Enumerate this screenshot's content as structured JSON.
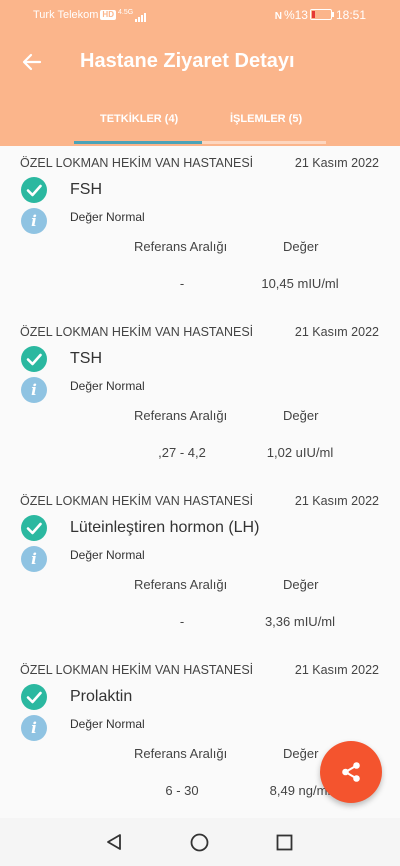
{
  "status_bar": {
    "carrier": "Turk Telekom",
    "network_badge": "HD",
    "network_type": "4.5G",
    "battery": "%13",
    "time": "18:51"
  },
  "header": {
    "title": "Hastane Ziyaret Detayı"
  },
  "tabs": [
    {
      "label": "TETKİKLER (4)",
      "active": true
    },
    {
      "label": "İŞLEMLER (5)",
      "active": false
    }
  ],
  "columns": {
    "reference": "Referans Aralığı",
    "value": "Değer"
  },
  "tests": [
    {
      "hospital": "ÖZEL LOKMAN HEKİM VAN HASTANESİ",
      "date": "21 Kasım 2022",
      "name": "FSH",
      "status": "Değer Normal",
      "reference": "-",
      "value": "10,45 mIU/ml"
    },
    {
      "hospital": "ÖZEL LOKMAN HEKİM VAN HASTANESİ",
      "date": "21 Kasım 2022",
      "name": "TSH",
      "status": "Değer Normal",
      "reference": ",27 - 4,2",
      "value": "1,02 uIU/ml"
    },
    {
      "hospital": "ÖZEL LOKMAN HEKİM VAN HASTANESİ",
      "date": "21 Kasım 2022",
      "name": "Lüteinleştiren hormon (LH)",
      "status": "Değer Normal",
      "reference": "-",
      "value": "3,36 mIU/ml"
    },
    {
      "hospital": "ÖZEL LOKMAN HEKİM VAN HASTANESİ",
      "date": "21 Kasım 2022",
      "name": "Prolaktin",
      "status": "Değer Normal",
      "reference": "6 - 30",
      "value": "8,49 ng/ml"
    }
  ],
  "colors": {
    "header": "#fbb58b",
    "tab_indicator": "#4aa3b8",
    "check": "#2bb8a0",
    "info": "#8fc3e2",
    "fab": "#f4542e"
  },
  "icons": {
    "back": "arrow-left-icon",
    "check": "check-circle-icon",
    "info": "info-icon",
    "share": "share-icon",
    "nav_back": "triangle-back-icon",
    "nav_home": "circle-home-icon",
    "nav_recent": "square-recent-icon"
  }
}
